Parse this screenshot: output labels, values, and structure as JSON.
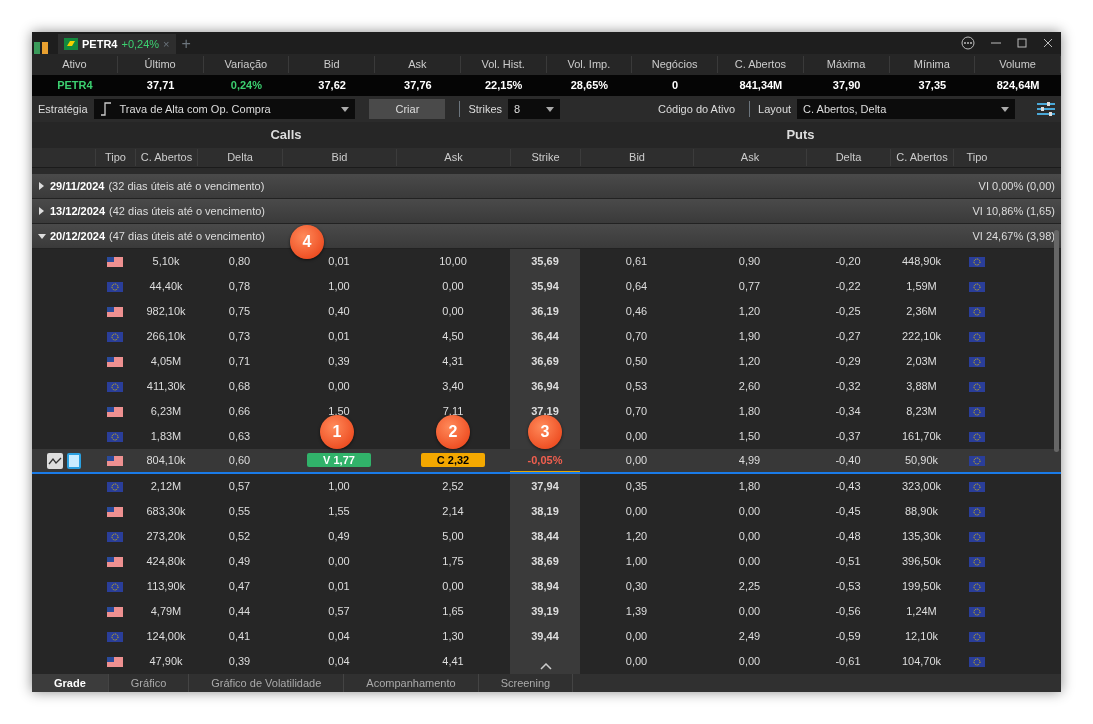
{
  "tab": {
    "symbol": "PETR4",
    "change": "+0,24%",
    "close": "×",
    "add": "+"
  },
  "quote": {
    "columns": [
      "Ativo",
      "Último",
      "Variação",
      "Bid",
      "Ask",
      "Vol. Hist.",
      "Vol. Imp.",
      "Negócios",
      "C. Abertos",
      "Máxima",
      "Mínima",
      "Volume"
    ],
    "values": [
      {
        "text": "PETR4",
        "positive": true
      },
      {
        "text": "37,71",
        "positive": false
      },
      {
        "text": "0,24%",
        "positive": true
      },
      {
        "text": "37,62",
        "positive": false
      },
      {
        "text": "37,76",
        "positive": false
      },
      {
        "text": "22,15%",
        "positive": false
      },
      {
        "text": "28,65%",
        "positive": false
      },
      {
        "text": "0",
        "positive": false
      },
      {
        "text": "841,34M",
        "positive": false
      },
      {
        "text": "37,90",
        "positive": false
      },
      {
        "text": "37,35",
        "positive": false
      },
      {
        "text": "824,64M",
        "positive": false
      }
    ]
  },
  "toolbar": {
    "strategy_label": "Estratégia",
    "strategy": "Trava de Alta com Op. Compra",
    "create": "Criar",
    "strikes_label": "Strikes",
    "strikes": "8",
    "asset_code_label": "Código do Ativo",
    "layout_label": "Layout",
    "layout": "C. Abertos, Delta"
  },
  "sections": {
    "calls": "Calls",
    "puts": "Puts"
  },
  "grid_columns": [
    "Tipo",
    "C. Abertos",
    "Delta",
    "Bid",
    "Ask",
    "Strike",
    "Bid",
    "Ask",
    "Delta",
    "C. Abertos",
    "Tipo"
  ],
  "expiries": [
    {
      "date": "29/11/2024",
      "note": "(32 dias úteis até o vencimento)",
      "vi": "VI 0,00% (0,00)",
      "expanded": false
    },
    {
      "date": "13/12/2024",
      "note": "(42 dias úteis até o vencimento)",
      "vi": "VI 10,86% (1,65)",
      "expanded": false
    },
    {
      "date": "20/12/2024",
      "note": "(47 dias úteis até o vencimento)",
      "vi": "VI 24,67% (3,98)",
      "expanded": true
    }
  ],
  "rows": [
    {
      "call_european": false,
      "call_oi": "5,10k",
      "call_delta": "0,80",
      "call_bid": "0,01",
      "call_ask": "10,00",
      "strike": "35,69",
      "put_bid": "0,61",
      "put_ask": "0,90",
      "put_delta": "-0,20",
      "put_oi": "448,90k",
      "put_european": true,
      "selected": false
    },
    {
      "call_european": true,
      "call_oi": "44,40k",
      "call_delta": "0,78",
      "call_bid": "1,00",
      "call_ask": "0,00",
      "strike": "35,94",
      "put_bid": "0,64",
      "put_ask": "0,77",
      "put_delta": "-0,22",
      "put_oi": "1,59M",
      "put_european": true,
      "selected": false
    },
    {
      "call_european": false,
      "call_oi": "982,10k",
      "call_delta": "0,75",
      "call_bid": "0,40",
      "call_ask": "0,00",
      "strike": "36,19",
      "put_bid": "0,46",
      "put_ask": "1,20",
      "put_delta": "-0,25",
      "put_oi": "2,36M",
      "put_european": true,
      "selected": false
    },
    {
      "call_european": true,
      "call_oi": "266,10k",
      "call_delta": "0,73",
      "call_bid": "0,01",
      "call_ask": "4,50",
      "strike": "36,44",
      "put_bid": "0,70",
      "put_ask": "1,90",
      "put_delta": "-0,27",
      "put_oi": "222,10k",
      "put_european": true,
      "selected": false
    },
    {
      "call_european": false,
      "call_oi": "4,05M",
      "call_delta": "0,71",
      "call_bid": "0,39",
      "call_ask": "4,31",
      "strike": "36,69",
      "put_bid": "0,50",
      "put_ask": "1,20",
      "put_delta": "-0,29",
      "put_oi": "2,03M",
      "put_european": true,
      "selected": false
    },
    {
      "call_european": true,
      "call_oi": "411,30k",
      "call_delta": "0,68",
      "call_bid": "0,00",
      "call_ask": "3,40",
      "strike": "36,94",
      "put_bid": "0,53",
      "put_ask": "2,60",
      "put_delta": "-0,32",
      "put_oi": "3,88M",
      "put_european": true,
      "selected": false
    },
    {
      "call_european": false,
      "call_oi": "6,23M",
      "call_delta": "0,66",
      "call_bid": "1,50",
      "call_ask": "7,11",
      "strike": "37,19",
      "put_bid": "0,70",
      "put_ask": "1,80",
      "put_delta": "-0,34",
      "put_oi": "8,23M",
      "put_european": true,
      "selected": false
    },
    {
      "call_european": true,
      "call_oi": "1,83M",
      "call_delta": "0,63",
      "put_bid": "0,00",
      "put_ask": "1,50",
      "put_delta": "-0,37",
      "put_oi": "161,70k",
      "put_european": true,
      "selected": false
    },
    {
      "call_european": false,
      "call_oi": "804,10k",
      "call_delta": "0,60",
      "call_bid_order": "V 1,77",
      "call_ask_order": "C 2,32",
      "strike_change": "-0,05%",
      "put_bid": "0,00",
      "put_ask": "4,99",
      "put_delta": "-0,40",
      "put_oi": "50,90k",
      "put_european": true,
      "selected": true
    },
    {
      "call_european": true,
      "call_oi": "2,12M",
      "call_delta": "0,57",
      "call_bid": "1,00",
      "call_ask": "2,52",
      "strike": "37,94",
      "put_bid": "0,35",
      "put_ask": "1,80",
      "put_delta": "-0,43",
      "put_oi": "323,00k",
      "put_european": true,
      "selected": false
    },
    {
      "call_european": false,
      "call_oi": "683,30k",
      "call_delta": "0,55",
      "call_bid": "1,55",
      "call_ask": "2,14",
      "strike": "38,19",
      "put_bid": "0,00",
      "put_ask": "0,00",
      "put_delta": "-0,45",
      "put_oi": "88,90k",
      "put_european": true,
      "selected": false
    },
    {
      "call_european": true,
      "call_oi": "273,20k",
      "call_delta": "0,52",
      "call_bid": "0,49",
      "call_ask": "5,00",
      "strike": "38,44",
      "put_bid": "1,20",
      "put_ask": "0,00",
      "put_delta": "-0,48",
      "put_oi": "135,30k",
      "put_european": true,
      "selected": false
    },
    {
      "call_european": false,
      "call_oi": "424,80k",
      "call_delta": "0,49",
      "call_bid": "0,00",
      "call_ask": "1,75",
      "strike": "38,69",
      "put_bid": "1,00",
      "put_ask": "0,00",
      "put_delta": "-0,51",
      "put_oi": "396,50k",
      "put_european": true,
      "selected": false
    },
    {
      "call_european": true,
      "call_oi": "113,90k",
      "call_delta": "0,47",
      "call_bid": "0,01",
      "call_ask": "0,00",
      "strike": "38,94",
      "put_bid": "0,30",
      "put_ask": "2,25",
      "put_delta": "-0,53",
      "put_oi": "199,50k",
      "put_european": true,
      "selected": false
    },
    {
      "call_european": false,
      "call_oi": "4,79M",
      "call_delta": "0,44",
      "call_bid": "0,57",
      "call_ask": "1,65",
      "strike": "39,19",
      "put_bid": "1,39",
      "put_ask": "0,00",
      "put_delta": "-0,56",
      "put_oi": "1,24M",
      "put_european": true,
      "selected": false
    },
    {
      "call_european": true,
      "call_oi": "124,00k",
      "call_delta": "0,41",
      "call_bid": "0,04",
      "call_ask": "1,30",
      "strike": "39,44",
      "put_bid": "0,00",
      "put_ask": "2,49",
      "put_delta": "-0,59",
      "put_oi": "12,10k",
      "put_european": true,
      "selected": false
    },
    {
      "call_european": false,
      "call_oi": "47,90k",
      "call_delta": "0,39",
      "call_bid": "0,04",
      "call_ask": "4,41",
      "put_bid": "0,00",
      "put_ask": "0,00",
      "put_delta": "-0,61",
      "put_oi": "104,70k",
      "put_european": true,
      "selected": false
    }
  ],
  "callouts": [
    "1",
    "2",
    "3",
    "4"
  ],
  "bottom_tabs": [
    {
      "label": "Grade",
      "selected": true
    },
    {
      "label": "Gráfico",
      "selected": false
    },
    {
      "label": "Gráfico de Volatilidade",
      "selected": false
    },
    {
      "label": "Acompanhamento",
      "selected": false
    },
    {
      "label": "Screening",
      "selected": false
    }
  ]
}
